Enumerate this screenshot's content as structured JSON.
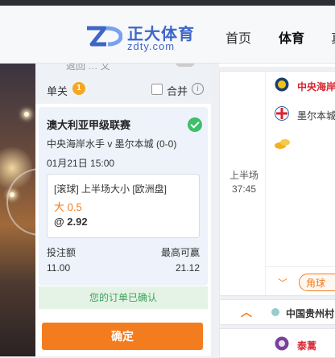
{
  "header": {
    "logo_cn": "正大体育",
    "logo_en": "zdty.com",
    "nav": [
      "首页",
      "体育",
      "真"
    ],
    "active_nav": "体育"
  },
  "slip": {
    "top_partial": "返回 …  又",
    "single_label": "单关",
    "single_count": "1",
    "merge_label": "合并",
    "info_icon": "i",
    "league": "澳大利亚甲级联赛",
    "teams": "中央海岸水手 v 墨尔本城 (0-0)",
    "datetime": "01月21日 15:00",
    "market": "[滚球] 上半场大小 [欧洲盘]",
    "pick": "大 0.5",
    "odds": "@ 2.92",
    "stake_label": "投注额",
    "stake_value": "11.00",
    "max_win_label": "最高可赢",
    "max_win_value": "21.12",
    "confirmed_text": "您的订单已确认",
    "confirm_button": "确定"
  },
  "match": {
    "period": "上半场",
    "clock": "37:45",
    "team1": "中央海岸",
    "team2": "墨尔本城",
    "corner_button": "角球"
  },
  "league_bar": {
    "league": "中国贵州村"
  },
  "match2": {
    "team": "泰蒿"
  },
  "colors": {
    "accent": "#f37c1f",
    "brand": "#3e66c9",
    "success": "#3fbf6a",
    "team_red": "#d9232d"
  }
}
